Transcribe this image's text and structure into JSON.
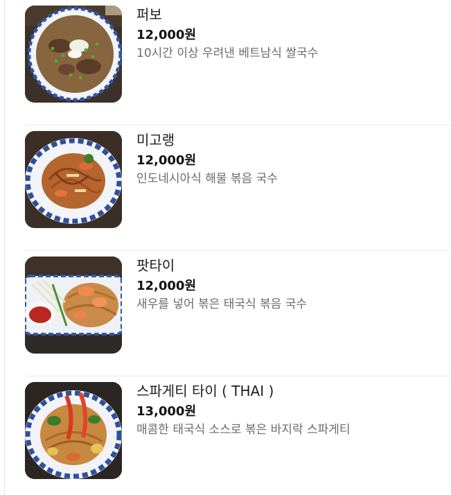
{
  "menu": {
    "items": [
      {
        "name": "퍼보",
        "price": "12,000원",
        "description": "10시간 이상 우려낸 베트남식 쌀국수",
        "image_icon": "pho-noodle-soup-photo"
      },
      {
        "name": "미고랭",
        "price": "12,000원",
        "description": "인도네시아식 해물 볶음 국수",
        "image_icon": "mie-goreng-photo"
      },
      {
        "name": "팟타이",
        "price": "12,000원",
        "description": "새우를 넣어 볶은 태국식 볶음 국수",
        "image_icon": "pad-thai-photo"
      },
      {
        "name": "스파게티 타이 ( THAI )",
        "price": "13,000원",
        "description": "매콤한 태국식 소스로 볶은 바지락 스파게티",
        "image_icon": "thai-spaghetti-photo"
      }
    ]
  },
  "colors": {
    "text_primary": "#1d1d1d",
    "text_secondary": "#6b6b6b",
    "divider": "#ececec"
  }
}
